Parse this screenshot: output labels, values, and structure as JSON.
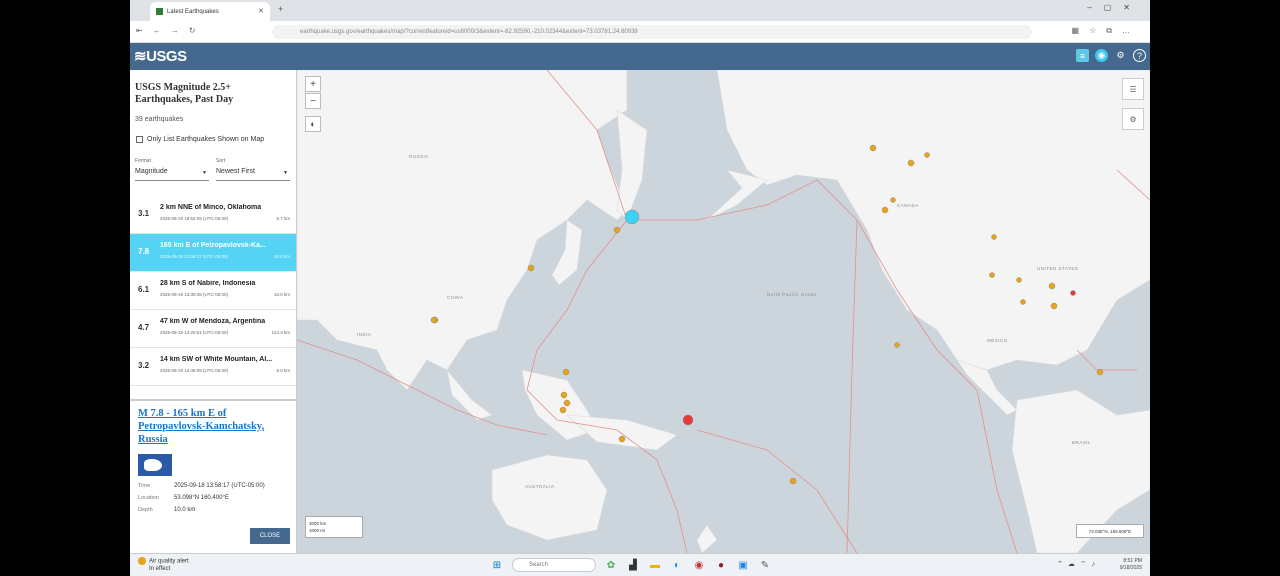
{
  "browser": {
    "tab_title": "Latest Earthquakes",
    "url": "earthquake.usgs.gov/earthquakes/map/?currentfeatureid=us6000r3&extent=-82.92590,-210.02344&extent=73.03781,24.60938"
  },
  "header": {
    "logo": "≋USGS"
  },
  "sidebar": {
    "title": "USGS Magnitude 2.5+ Earthquakes, Past Day",
    "count": "39 earthquakes",
    "checkbox_label": "Only List Earthquakes Shown on Map",
    "format_label": "Format",
    "format_value": "Magnitude",
    "sort_label": "Sort",
    "sort_value": "Newest First",
    "earthquakes": [
      {
        "mag": "3.1",
        "place": "2 km NNE of Minco, Oklahoma",
        "time": "2025-09-18 19:52:09 (UTC-05:00)",
        "depth": "6.7 km"
      },
      {
        "mag": "7.8",
        "place": "165 km E of Petropavlovsk-Ka...",
        "time": "2025-09-18 13:58:17 (UTC-05:00)",
        "depth": "10.0 km"
      },
      {
        "mag": "6.1",
        "place": "28 km S of Nabire, Indonesia",
        "time": "2025-09-18 13:39:48 (UTC-05:00)",
        "depth": "10.0 km"
      },
      {
        "mag": "4.7",
        "place": "47 km W of Mendoza, Argentina",
        "time": "2025-09-18 13:20:51 (UTC-05:00)",
        "depth": "124.4 km"
      },
      {
        "mag": "3.2",
        "place": "14 km SW of White Mountain, Al...",
        "time": "2025-09-18 12:46:05 (UTC-05:00)",
        "depth": "5.0 km"
      }
    ]
  },
  "detail": {
    "title": "M 7.8 - 165 km E of Petropavlovsk-Kamchatsky, Russia",
    "time_label": "Time",
    "time_value": "2025-09-18 13:58:17 (UTC-05:00)",
    "location_label": "Location",
    "location_value": "53.098°N 160.400°E",
    "depth_label": "Depth",
    "depth_value": "10.0 km",
    "close_label": "CLOSE"
  },
  "map": {
    "zoom_in": "+",
    "zoom_out": "−",
    "scale_line1": "3000 km",
    "scale_line2": "1000 mi",
    "coords": "73.038°N, 159.609°E",
    "labels": [
      "RUSSIA",
      "CHINA",
      "INDIA",
      "CANADA",
      "UNITED STATES",
      "MEXICO",
      "AUSTRALIA",
      "North Pacific Ocean",
      "BRASIL"
    ]
  },
  "status": {
    "line1": "Air quality alert",
    "line2": "In effect",
    "search_placeholder": "Search",
    "time": "8:51 PM",
    "date": "9/18/2025"
  },
  "colors": {
    "header": "#44688e",
    "selected_row": "#54d3f5",
    "quake_orange": "#e8a317",
    "quake_red": "#e53935",
    "quake_cyan": "#3fd0f5"
  }
}
